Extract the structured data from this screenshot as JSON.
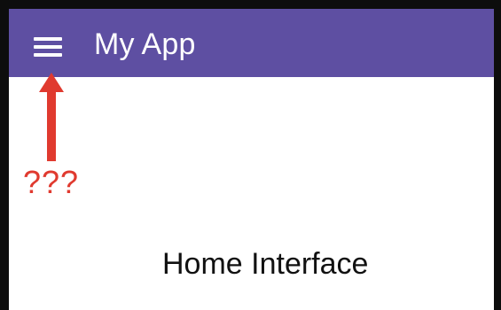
{
  "app": {
    "title": "My App",
    "menu_icon": "hamburger-menu-icon",
    "appbar_color": "#5e4fa2"
  },
  "annotation": {
    "text": "???",
    "color": "#e03a2f",
    "arrow_icon": "up-arrow-icon"
  },
  "main": {
    "content_text": "Home Interface"
  }
}
